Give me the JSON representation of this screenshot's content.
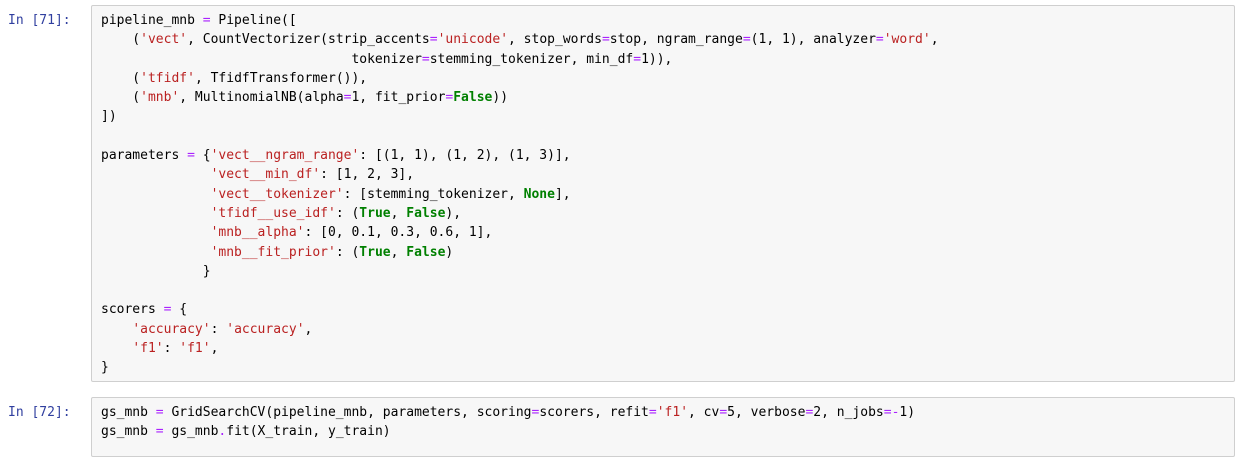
{
  "cells": [
    {
      "prompt": "In [71]:",
      "lines": [
        [
          [
            "t",
            "pipeline_mnb "
          ],
          [
            "o",
            "="
          ],
          [
            "t",
            " Pipeline(["
          ]
        ],
        [
          [
            "t",
            "    ("
          ],
          [
            "s",
            "'vect'"
          ],
          [
            "t",
            ", CountVectorizer(strip_accents"
          ],
          [
            "o",
            "="
          ],
          [
            "s",
            "'unicode'"
          ],
          [
            "t",
            ", stop_words"
          ],
          [
            "o",
            "="
          ],
          [
            "t",
            "stop, ngram_range"
          ],
          [
            "o",
            "="
          ],
          [
            "t",
            "(1, 1), analyzer"
          ],
          [
            "o",
            "="
          ],
          [
            "s",
            "'word'"
          ],
          [
            "t",
            ","
          ]
        ],
        [
          [
            "t",
            "                                tokenizer"
          ],
          [
            "o",
            "="
          ],
          [
            "t",
            "stemming_tokenizer, min_df"
          ],
          [
            "o",
            "="
          ],
          [
            "t",
            "1)),"
          ]
        ],
        [
          [
            "t",
            "    ("
          ],
          [
            "s",
            "'tfidf'"
          ],
          [
            "t",
            ", TfidfTransformer()),"
          ]
        ],
        [
          [
            "t",
            "    ("
          ],
          [
            "s",
            "'mnb'"
          ],
          [
            "t",
            ", MultinomialNB(alpha"
          ],
          [
            "o",
            "="
          ],
          [
            "t",
            "1, fit_prior"
          ],
          [
            "o",
            "="
          ],
          [
            "k",
            "False"
          ],
          [
            "t",
            "))"
          ]
        ],
        [
          [
            "t",
            "])"
          ]
        ],
        [
          [
            "t",
            ""
          ]
        ],
        [
          [
            "t",
            "parameters "
          ],
          [
            "o",
            "="
          ],
          [
            "t",
            " {"
          ],
          [
            "s",
            "'vect__ngram_range'"
          ],
          [
            "t",
            ": [(1, 1), (1, 2), (1, 3)],"
          ]
        ],
        [
          [
            "t",
            "              "
          ],
          [
            "s",
            "'vect__min_df'"
          ],
          [
            "t",
            ": [1, 2, 3],"
          ]
        ],
        [
          [
            "t",
            "              "
          ],
          [
            "s",
            "'vect__tokenizer'"
          ],
          [
            "t",
            ": [stemming_tokenizer, "
          ],
          [
            "k",
            "None"
          ],
          [
            "t",
            "],"
          ]
        ],
        [
          [
            "t",
            "              "
          ],
          [
            "s",
            "'tfidf__use_idf'"
          ],
          [
            "t",
            ": ("
          ],
          [
            "k",
            "True"
          ],
          [
            "t",
            ", "
          ],
          [
            "k",
            "False"
          ],
          [
            "t",
            "),"
          ]
        ],
        [
          [
            "t",
            "              "
          ],
          [
            "s",
            "'mnb__alpha'"
          ],
          [
            "t",
            ": [0, 0.1, 0.3, 0.6, 1],"
          ]
        ],
        [
          [
            "t",
            "              "
          ],
          [
            "s",
            "'mnb__fit_prior'"
          ],
          [
            "t",
            ": ("
          ],
          [
            "k",
            "True"
          ],
          [
            "t",
            ", "
          ],
          [
            "k",
            "False"
          ],
          [
            "t",
            ")"
          ]
        ],
        [
          [
            "t",
            "             }"
          ]
        ],
        [
          [
            "t",
            ""
          ]
        ],
        [
          [
            "t",
            "scorers "
          ],
          [
            "o",
            "="
          ],
          [
            "t",
            " {"
          ]
        ],
        [
          [
            "t",
            "    "
          ],
          [
            "s",
            "'accuracy'"
          ],
          [
            "t",
            ": "
          ],
          [
            "s",
            "'accuracy'"
          ],
          [
            "t",
            ","
          ]
        ],
        [
          [
            "t",
            "    "
          ],
          [
            "s",
            "'f1'"
          ],
          [
            "t",
            ": "
          ],
          [
            "s",
            "'f1'"
          ],
          [
            "t",
            ","
          ]
        ],
        [
          [
            "t",
            "}"
          ]
        ]
      ]
    },
    {
      "prompt": "In [72]:",
      "lines": [
        [
          [
            "t",
            "gs_mnb "
          ],
          [
            "o",
            "="
          ],
          [
            "t",
            " GridSearchCV(pipeline_mnb, parameters, scoring"
          ],
          [
            "o",
            "="
          ],
          [
            "t",
            "scorers, refit"
          ],
          [
            "o",
            "="
          ],
          [
            "s",
            "'f1'"
          ],
          [
            "t",
            ", cv"
          ],
          [
            "o",
            "="
          ],
          [
            "t",
            "5, verbose"
          ],
          [
            "o",
            "="
          ],
          [
            "t",
            "2, n_jobs"
          ],
          [
            "o",
            "="
          ],
          [
            "o",
            "-"
          ],
          [
            "t",
            "1)"
          ]
        ],
        [
          [
            "t",
            "gs_mnb "
          ],
          [
            "o",
            "="
          ],
          [
            "t",
            " gs_mnb"
          ],
          [
            "o",
            "."
          ],
          [
            "t",
            "fit(X_train, y_train)"
          ]
        ]
      ]
    }
  ]
}
